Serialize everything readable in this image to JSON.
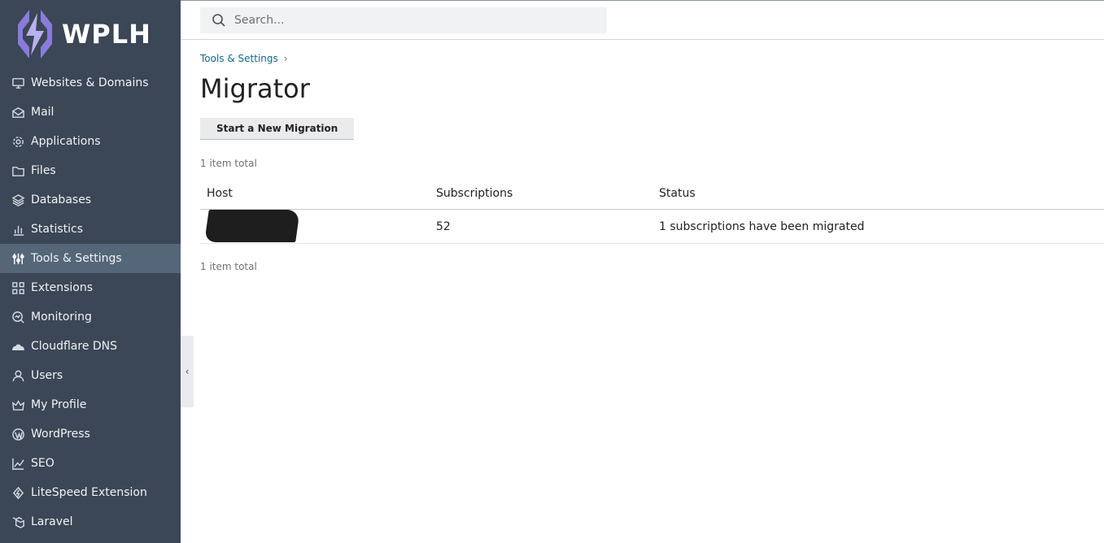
{
  "brand": {
    "name": "WPLH",
    "logo_icon": "lightning-logo-icon",
    "logo_color": "#8a7bdc"
  },
  "search": {
    "placeholder": "Search..."
  },
  "sidebar": {
    "items": [
      {
        "label": "Websites & Domains",
        "icon": "monitor-icon"
      },
      {
        "label": "Mail",
        "icon": "mail-icon"
      },
      {
        "label": "Applications",
        "icon": "gear-icon"
      },
      {
        "label": "Files",
        "icon": "folder-icon"
      },
      {
        "label": "Databases",
        "icon": "layers-icon"
      },
      {
        "label": "Statistics",
        "icon": "bar-chart-icon"
      },
      {
        "label": "Tools & Settings",
        "icon": "sliders-icon",
        "active": true
      },
      {
        "label": "Extensions",
        "icon": "grid-icon"
      },
      {
        "label": "Monitoring",
        "icon": "monitoring-icon"
      },
      {
        "label": "Cloudflare DNS",
        "icon": "cloud-icon"
      },
      {
        "label": "Users",
        "icon": "user-icon"
      },
      {
        "label": "My Profile",
        "icon": "crown-icon"
      },
      {
        "label": "WordPress",
        "icon": "wordpress-icon"
      },
      {
        "label": "SEO",
        "icon": "seo-chart-icon"
      },
      {
        "label": "LiteSpeed Extension",
        "icon": "litespeed-icon"
      },
      {
        "label": "Laravel",
        "icon": "laravel-icon"
      }
    ],
    "active_bg": "#546678",
    "bg": "#3b4656"
  },
  "breadcrumb": {
    "items": [
      "Tools & Settings"
    ],
    "separator": "›"
  },
  "page": {
    "title": "Migrator",
    "new_migration_label": "Start a New Migration",
    "count_top": "1 item total",
    "count_bottom": "1 item total"
  },
  "table": {
    "headers": [
      "Host",
      "Subscriptions",
      "Status"
    ],
    "rows": [
      {
        "host": "",
        "subscriptions": "52",
        "status": "1 subscriptions have been migrated"
      }
    ]
  }
}
